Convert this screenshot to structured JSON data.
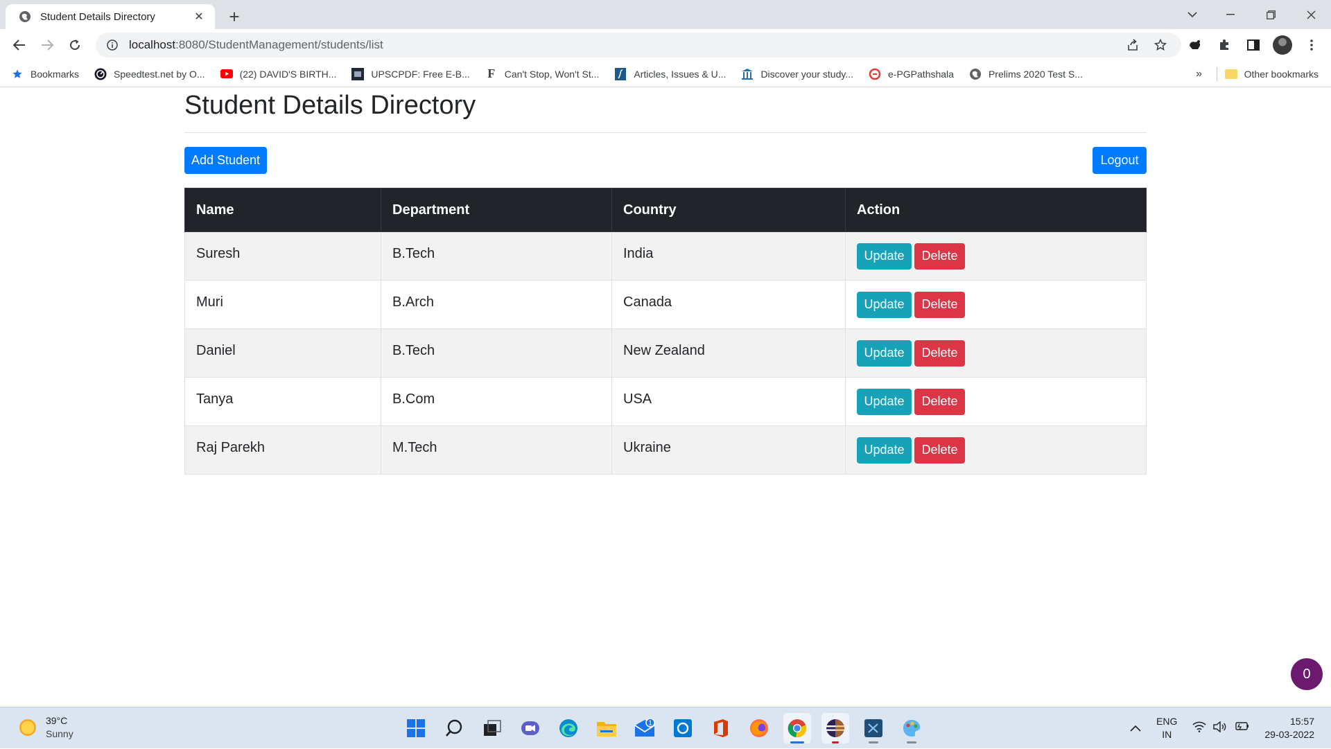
{
  "browser": {
    "tab_title": "Student Details Directory",
    "url_host": "localhost",
    "url_path": ":8080/StudentManagement/students/list",
    "bookmarks": [
      {
        "label": "Bookmarks",
        "icon": "star-icon"
      },
      {
        "label": "Speedtest.net by O...",
        "icon": "speedtest-icon"
      },
      {
        "label": "(22) DAVID'S BIRTH...",
        "icon": "youtube-icon"
      },
      {
        "label": "UPSCPDF: Free E-B...",
        "icon": "upscpdf-icon"
      },
      {
        "label": "Can't Stop, Won't St...",
        "icon": "f-letter-icon"
      },
      {
        "label": "Articles, Issues & U...",
        "icon": "journal-icon"
      },
      {
        "label": "Discover your study...",
        "icon": "library-icon"
      },
      {
        "label": "e-PGPathshala",
        "icon": "epg-icon"
      },
      {
        "label": "Prelims 2020 Test S...",
        "icon": "globe-icon"
      }
    ],
    "bookmarks_more": "»",
    "other_bookmarks": "Other bookmarks"
  },
  "page": {
    "title": "Student Details Directory",
    "add_button": "Add Student",
    "logout_button": "Logout",
    "table": {
      "headers": [
        "Name",
        "Department",
        "Country",
        "Action"
      ],
      "rows": [
        {
          "name": "Suresh",
          "department": "B.Tech",
          "country": "India"
        },
        {
          "name": "Muri",
          "department": "B.Arch",
          "country": "Canada"
        },
        {
          "name": "Daniel",
          "department": "B.Tech",
          "country": "New Zealand"
        },
        {
          "name": "Tanya",
          "department": "B.Com",
          "country": "USA"
        },
        {
          "name": "Raj Parekh",
          "department": "M.Tech",
          "country": "Ukraine"
        }
      ],
      "update_label": "Update",
      "delete_label": "Delete"
    },
    "fab_count": "0"
  },
  "taskbar": {
    "weather_temp": "39°C",
    "weather_condition": "Sunny",
    "lang_line1": "ENG",
    "lang_line2": "IN",
    "time": "15:57",
    "date": "29-03-2022",
    "mail_badge": "1"
  },
  "colors": {
    "primary": "#007bff",
    "info": "#17a2b8",
    "danger": "#dc3545",
    "table_header": "#212529"
  }
}
